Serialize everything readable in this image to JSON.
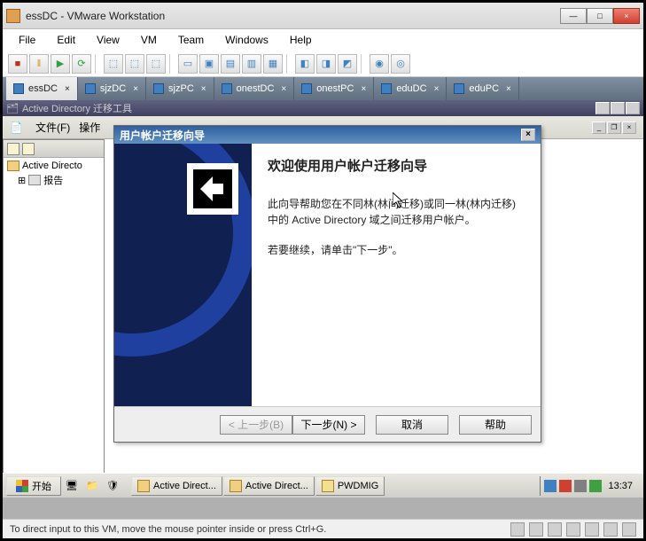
{
  "window": {
    "title": "essDC - VMware Workstation",
    "minimize": "—",
    "maximize": "□",
    "close": "×"
  },
  "menu": {
    "file": "File",
    "edit": "Edit",
    "view": "View",
    "vm": "VM",
    "team": "Team",
    "windows": "Windows",
    "help": "Help"
  },
  "tabs": [
    {
      "label": "essDC",
      "active": true
    },
    {
      "label": "sjzDC",
      "active": false
    },
    {
      "label": "sjzPC",
      "active": false
    },
    {
      "label": "onestDC",
      "active": false
    },
    {
      "label": "onestPC",
      "active": false
    },
    {
      "label": "eduDC",
      "active": false
    },
    {
      "label": "eduPC",
      "active": false
    }
  ],
  "guest": {
    "mdi_title": "Active Directory 迁移工具",
    "file_menu": "文件(F)",
    "action_menu": "操作",
    "tree_root": "Active Directo",
    "tree_reports": "报告",
    "start": "开始",
    "taskbar_items": [
      "Active Direct...",
      "Active Direct...",
      "PWDMIG"
    ],
    "clock": "13:37"
  },
  "wizard": {
    "title": "用户帐户迁移向导",
    "heading": "欢迎使用用户帐户迁移向导",
    "desc1": "此向导帮助您在不同林(林间迁移)或同一林(林内迁移)中的 Active Directory 域之间迁移用户帐户。",
    "desc2": "若要继续，请单击\"下一步\"。",
    "back": "< 上一步(B)",
    "next": "下一步(N) >",
    "cancel": "取消",
    "help": "帮助",
    "close": "×"
  },
  "statusbar": {
    "hint": "To direct input to this VM, move the mouse pointer inside or press Ctrl+G."
  },
  "icons": {
    "toolbar_main": [
      "■",
      "‖",
      "▶",
      "⟳"
    ],
    "toolbar_vm": [
      "⬚",
      "⬚",
      "⬚"
    ],
    "toolbar_view": [
      "▭",
      "▣",
      "▤",
      "▥",
      "▦"
    ],
    "toolbar_misc": [
      "◧",
      "◨",
      "◩"
    ],
    "toolbar_right": [
      "◉",
      "◎"
    ]
  }
}
